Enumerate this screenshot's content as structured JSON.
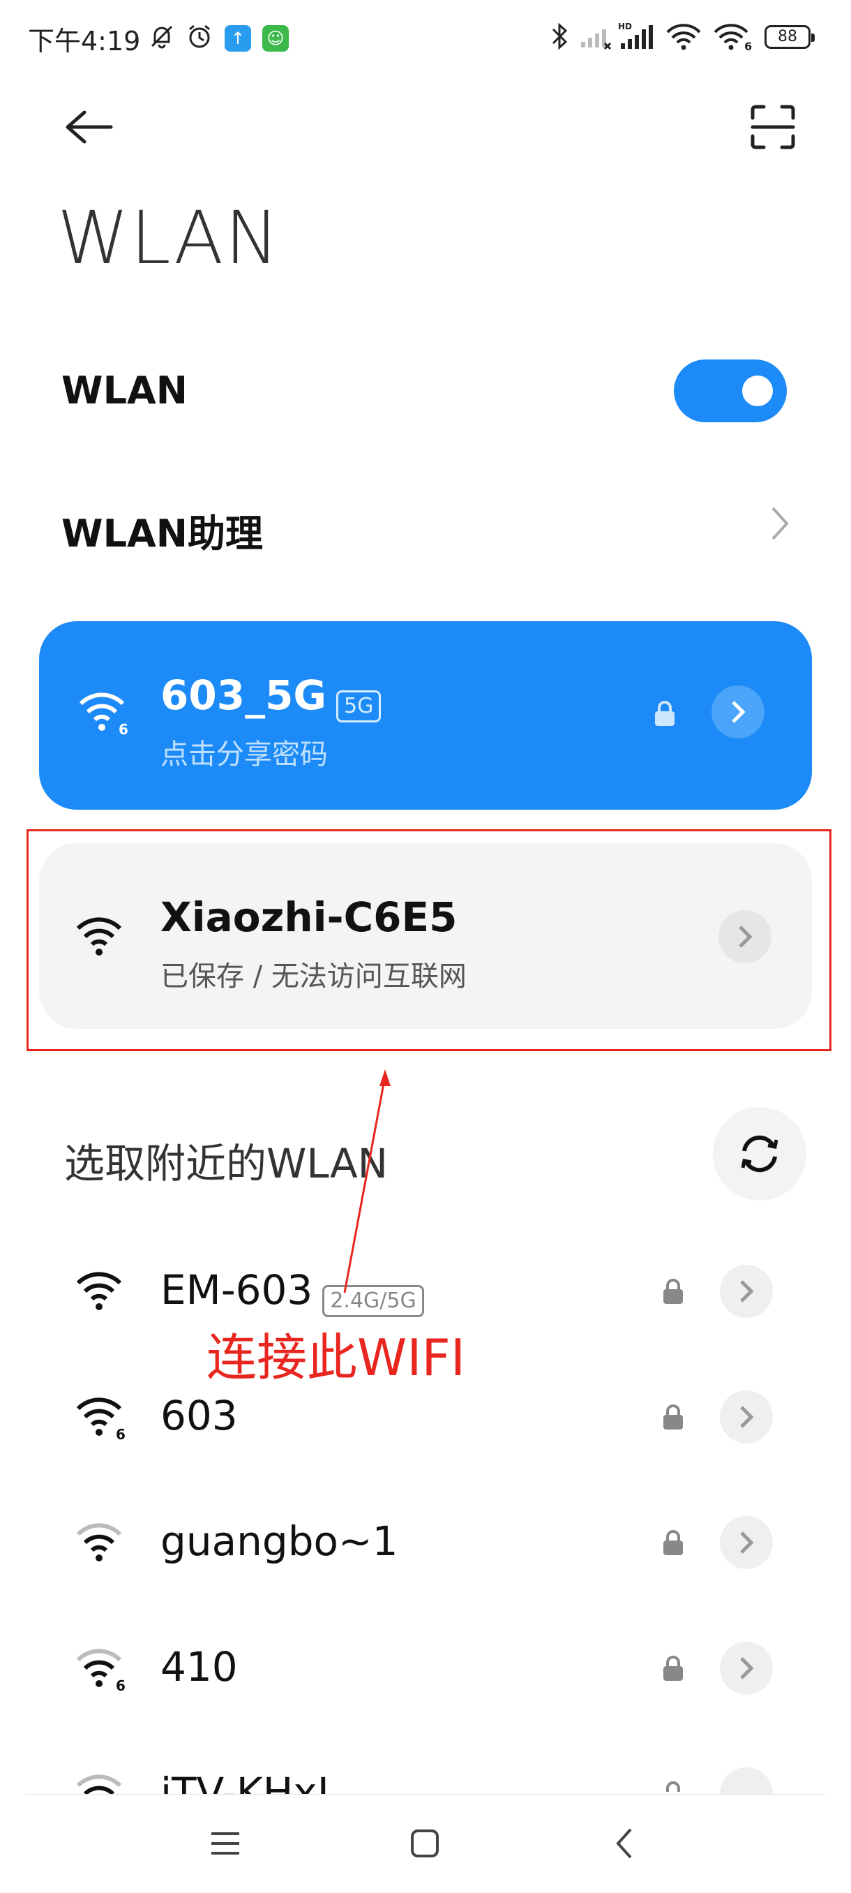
{
  "status_bar": {
    "time": "下午4:19",
    "battery": "88",
    "hd_label": "HD"
  },
  "header": {
    "title": "WLAN"
  },
  "wlan_toggle": {
    "label": "WLAN",
    "state": "on"
  },
  "assistant": {
    "label": "WLAN助理"
  },
  "connected_network": {
    "name": "603_5G",
    "band": "5G",
    "subtitle": "点击分享密码"
  },
  "saved_network": {
    "name": "Xiaozhi-C6E5",
    "subtitle": "已保存 / 无法访问互联网"
  },
  "nearby": {
    "title": "选取附近的WLAN"
  },
  "networks": [
    {
      "name": "EM-603",
      "band": "2.4G/5G"
    },
    {
      "name": "603"
    },
    {
      "name": "guangbo~1"
    },
    {
      "name": "410"
    },
    {
      "name": "iTV-KHxL"
    }
  ],
  "annotation": {
    "text": "连接此WIFI"
  },
  "colors": {
    "accent": "#1c8bf7",
    "annotation": "#e8261f"
  }
}
